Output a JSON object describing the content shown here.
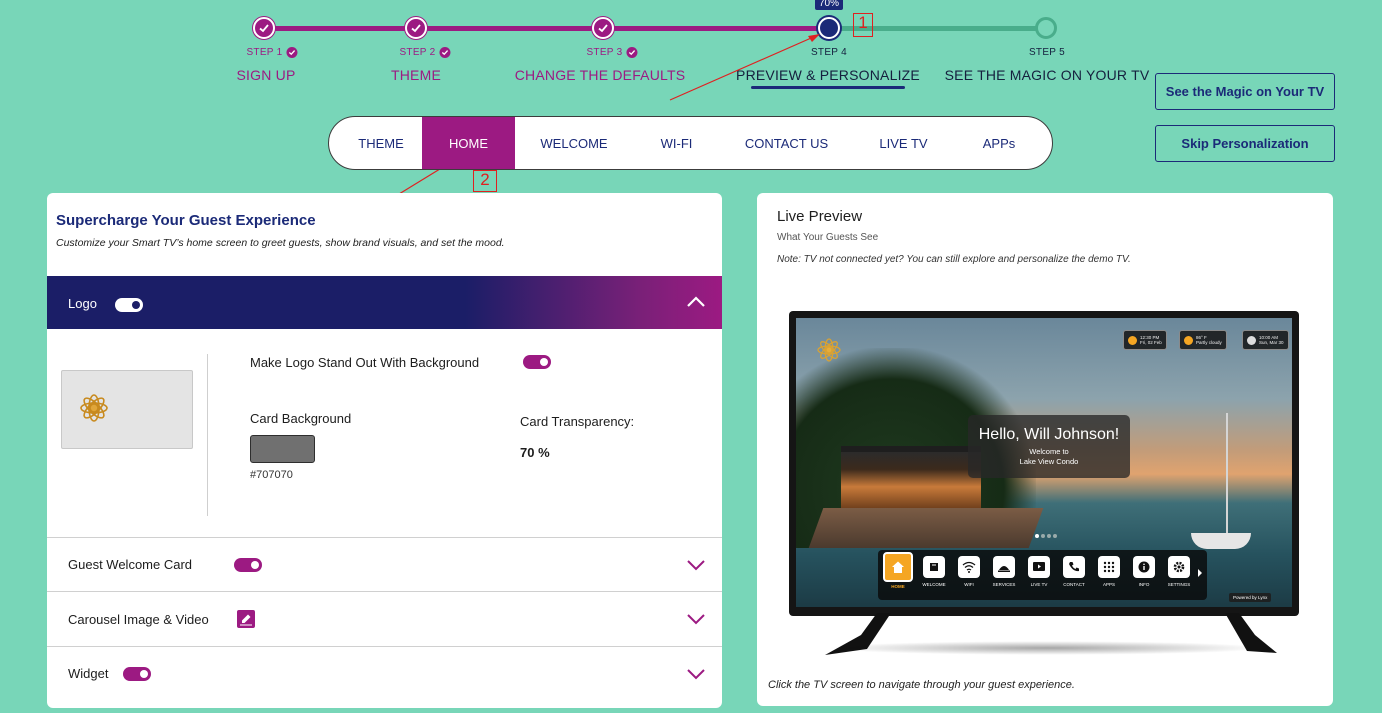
{
  "stepper": {
    "progress_badge": "70%",
    "steps": [
      {
        "num": "STEP 1",
        "title": "SIGN UP",
        "state": "done"
      },
      {
        "num": "STEP 2",
        "title": "THEME",
        "state": "done"
      },
      {
        "num": "STEP 3",
        "title": "CHANGE THE DEFAULTS",
        "state": "done"
      },
      {
        "num": "STEP 4",
        "title": "PREVIEW & PERSONALIZE",
        "state": "current"
      },
      {
        "num": "STEP 5",
        "title": "SEE THE MAGIC ON YOUR TV",
        "state": "todo"
      }
    ]
  },
  "annotations": {
    "marker1": "1",
    "marker2": "2",
    "color": "#e02020"
  },
  "side_buttons": {
    "magic": "See the Magic on Your TV",
    "skip": "Skip Personalization"
  },
  "tabs": [
    {
      "label": "THEME"
    },
    {
      "label": "HOME",
      "active": true
    },
    {
      "label": "WELCOME"
    },
    {
      "label": "WI-FI"
    },
    {
      "label": "CONTACT US"
    },
    {
      "label": "LIVE TV"
    },
    {
      "label": "APPs"
    }
  ],
  "left_panel": {
    "title": "Supercharge Your Guest Experience",
    "subtitle": "Customize your Smart TV’s home screen to greet guests, show brand visuals, and set the mood.",
    "logo_section": {
      "label": "Logo",
      "toggle_on": true,
      "stand_out_label": "Make Logo Stand Out With Background",
      "stand_out_on": true,
      "card_background_label": "Card Background",
      "card_background_value": "#707070",
      "card_transparency_label": "Card Transparency:",
      "card_transparency_value": "70 %"
    },
    "sections": [
      {
        "label": "Guest Welcome Card",
        "control": "toggle",
        "on": true
      },
      {
        "label": "Carousel Image & Video",
        "control": "edit"
      },
      {
        "label": "Widget",
        "control": "toggle",
        "on": true
      }
    ]
  },
  "right_panel": {
    "title": "Live Preview",
    "subtitle": "What Your Guests See",
    "note": "Note: TV not connected yet? You can still explore and personalize the demo TV.",
    "footer": "Click the TV screen to navigate through your guest experience.",
    "tv": {
      "status_chips": [
        {
          "line1": "12:30 PM",
          "line2": "Fri, 02 Feb"
        },
        {
          "line1": "86° F",
          "line2": "Partly cloudy"
        },
        {
          "line1": "10:00 AM",
          "line2": "Sun, Mar 30"
        }
      ],
      "greeting": "Hello, Will Johnson!",
      "welcome_line1": "Welcome to",
      "welcome_line2": "Lake View Condo",
      "dock": [
        "HOME",
        "WELCOME",
        "WIFI",
        "SERVICES",
        "LIVE TV",
        "CONTACT",
        "APPS",
        "INFO",
        "SETTINGS"
      ],
      "powered_by": "Powered by",
      "brand": "Lynx"
    }
  },
  "colors": {
    "accent": "#9c1a82",
    "navy": "#1b2a78",
    "background": "#78d6b8"
  }
}
